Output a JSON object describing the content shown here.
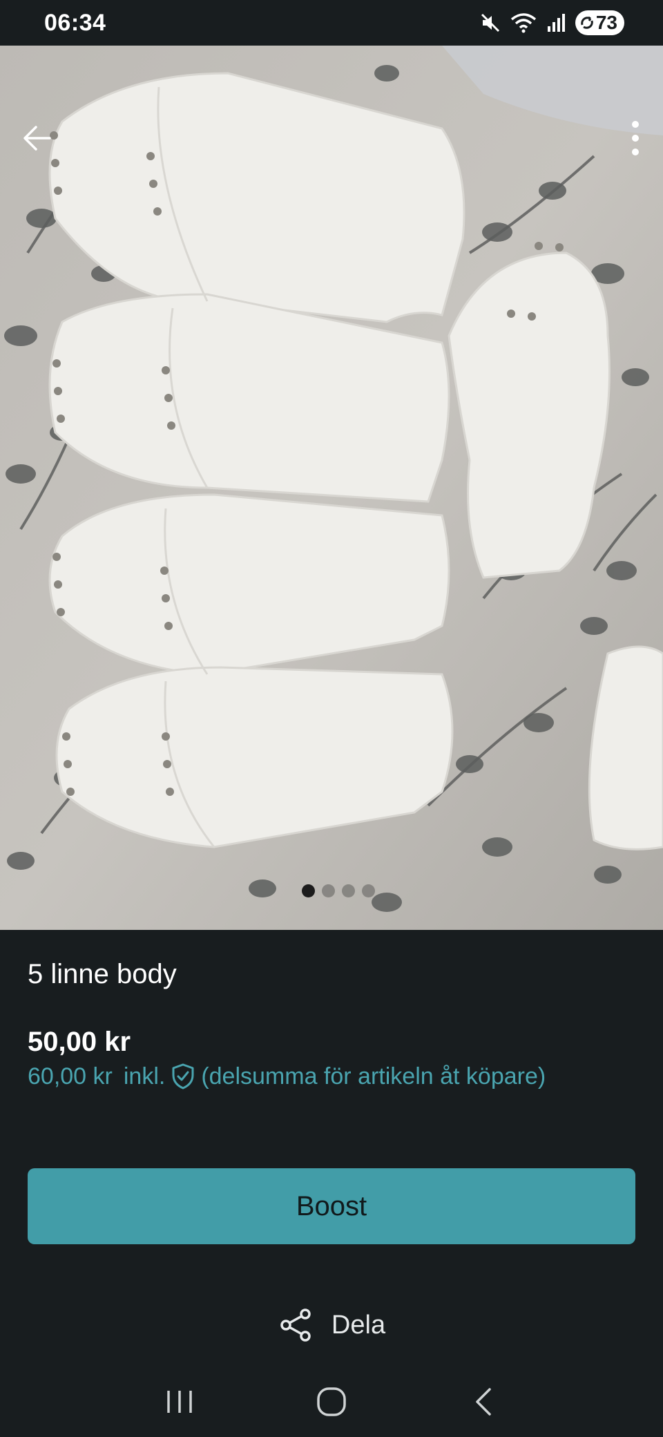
{
  "status_bar": {
    "time": "06:34",
    "battery_level": "73",
    "icons": [
      "mute-icon",
      "wifi-icon",
      "signal-icon",
      "battery-icon"
    ]
  },
  "listing": {
    "title": "5 linne body",
    "price": "50,00 kr",
    "buyer_price": "60,00 kr",
    "buyer_price_inkl": "inkl.",
    "buyer_price_note": "(delsumma för artikeln åt köpare)",
    "image_count": 4,
    "active_image": 1
  },
  "actions": {
    "boost_label": "Boost",
    "share_label": "Dela"
  },
  "colors": {
    "background": "#181d1f",
    "accent": "#429da8",
    "accent_text": "#4aa5b0"
  }
}
